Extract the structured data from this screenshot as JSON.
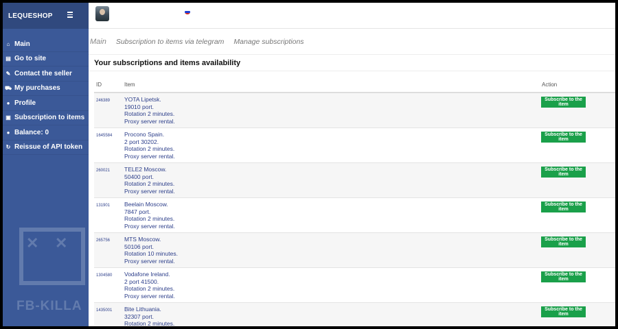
{
  "app": {
    "brand": "LEQUESHOP"
  },
  "sidebar": {
    "items": [
      {
        "icon": "home-icon",
        "glyph": "⌂",
        "label": "Main"
      },
      {
        "icon": "storefront-icon",
        "glyph": "▤",
        "label": "Go to site"
      },
      {
        "icon": "pen-icon",
        "glyph": "✎",
        "label": "Contact the seller"
      },
      {
        "icon": "cart-icon",
        "glyph": "⛟",
        "label": "My purchases"
      },
      {
        "icon": "user-icon",
        "glyph": "●",
        "label": "Profile"
      },
      {
        "icon": "bell-icon",
        "glyph": "▣",
        "label": "Subscription to items"
      },
      {
        "icon": "wallet-icon",
        "glyph": "●",
        "label": "Balance: 0"
      },
      {
        "icon": "refresh-icon",
        "glyph": "↻",
        "label": "Reissue of API token"
      }
    ],
    "watermark": {
      "text": "FB-KILLA"
    }
  },
  "topbar": {
    "flag_colors": [
      "#ffffff",
      "#1c3fd6",
      "#d52b1e"
    ]
  },
  "tabs": [
    {
      "label": "Main"
    },
    {
      "label": "Subscription to items via telegram"
    },
    {
      "label": "Manage subscriptions"
    }
  ],
  "main": {
    "title": "Your subscriptions and items availability",
    "table": {
      "headers": {
        "id": "ID",
        "item": "Item",
        "action": "Action"
      },
      "button_label": "Subscribe to the item",
      "rows": [
        {
          "id": "246389",
          "lines": [
            "YOTA Lipetsk.",
            "19010 port.",
            "Rotation 2 minutes.",
            "Proxy server rental."
          ]
        },
        {
          "id": "1645584",
          "lines": [
            "Procono Spain.",
            "2 port 30202.",
            "Rotation 2 minutes.",
            "Proxy server rental."
          ]
        },
        {
          "id": "260021",
          "lines": [
            "TELE2 Moscow.",
            "50400 port.",
            "Rotation 2 minutes.",
            "Proxy server rental."
          ]
        },
        {
          "id": "131901",
          "lines": [
            "Beelain Moscow.",
            "7847 port.",
            "Rotation 2 minutes.",
            "Proxy server rental."
          ]
        },
        {
          "id": "265756",
          "lines": [
            "MTS Moscow.",
            "50106 port.",
            "Rotation 10 minutes.",
            "Proxy server rental."
          ]
        },
        {
          "id": "1304580",
          "lines": [
            "Vodafone Ireland.",
            "2 port 41500.",
            "Rotation 2 minutes.",
            "Proxy server rental."
          ]
        },
        {
          "id": "1435001",
          "lines": [
            "Bite Lithuania.",
            "32307 port.",
            "Rotation 2 minutes."
          ]
        }
      ]
    }
  },
  "colors": {
    "sidebar": "#3b5998",
    "button": "#1aa04a",
    "link_text": "#2c3e8a"
  }
}
